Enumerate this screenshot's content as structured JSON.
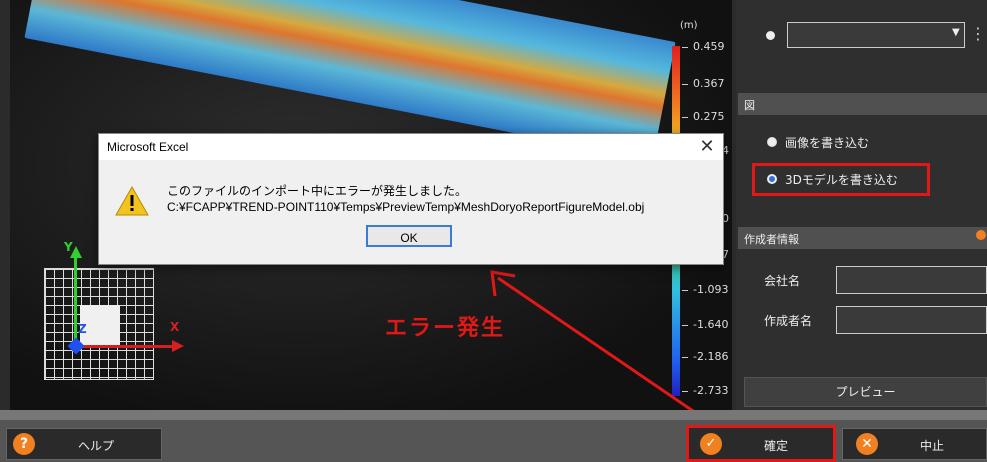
{
  "viewport": {
    "scale_unit": "(m)",
    "scale_ticks": [
      "0.459",
      "0.367",
      "0.275",
      "-1.093",
      "-1.640",
      "-2.186",
      "-2.733"
    ],
    "scale_partial": [
      "4",
      "0",
      "7"
    ],
    "axis_labels": {
      "y": "Y",
      "x": "X",
      "z": "Z"
    }
  },
  "dialog": {
    "title": "Microsoft Excel",
    "close": "✕",
    "message_line1": "このファイルのインポート中にエラーが発生しました。",
    "message_line2": "C:¥FCAPP¥TREND-POINT110¥Temps¥PreviewTemp¥MeshDoryoReportFigureModel.obj",
    "ok_label": "OK",
    "icon": "warning-icon"
  },
  "annotation": {
    "text": "エラー発生",
    "color": "#e01818"
  },
  "right_panel": {
    "figure_section": "図",
    "option_image": "画像を書き込む",
    "option_3d": "3Dモデルを書き込む",
    "selected_option": "option_3d",
    "author_section": "作成者情報",
    "company_label": "会社名",
    "author_label": "作成者名",
    "preview_label": "プレビュー"
  },
  "bottom_bar": {
    "help_label": "ヘルプ",
    "confirm_label": "確定",
    "cancel_label": "中止"
  },
  "colors": {
    "highlight": "#e01818",
    "accent": "#f08020",
    "selected_radio": "#2f6fe0"
  }
}
